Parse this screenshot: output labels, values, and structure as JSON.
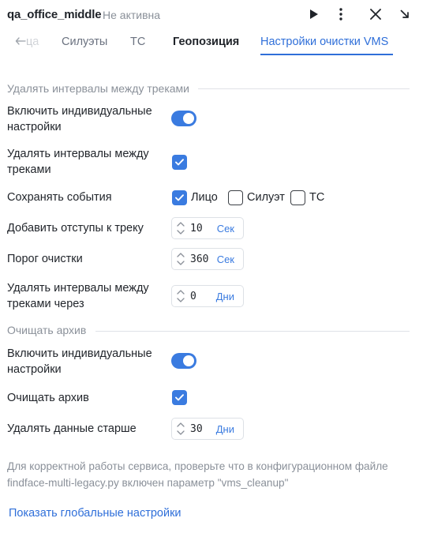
{
  "header": {
    "title": "qa_office_middle",
    "status": "Не активна",
    "icons": [
      "play-icon",
      "kebab-menu-icon",
      "close-icon",
      "collapse-icon"
    ]
  },
  "tabs": [
    {
      "label": "ца",
      "truncated": true
    },
    {
      "label": "Силуэты"
    },
    {
      "label": "ТС"
    },
    {
      "label": "Геопозиция"
    },
    {
      "label": "Настройки очистки VMS",
      "active": true
    }
  ],
  "section_intervals": {
    "title": "Удалять интервалы между треками",
    "individual_label": "Включить индивидуальные настройки",
    "individual_on": true,
    "remove_intervals_label": "Удалять интервалы между треками",
    "remove_intervals_checked": true,
    "keep_events_label": "Сохранять события",
    "events": [
      {
        "label": "Лицо",
        "checked": true
      },
      {
        "label": "Силуэт",
        "checked": false
      },
      {
        "label": "ТС",
        "checked": false
      }
    ],
    "padding_label": "Добавить отступы к треку",
    "padding_value": "10",
    "padding_unit": "Сек",
    "threshold_label": "Порог очистки",
    "threshold_value": "360",
    "threshold_unit": "Сек",
    "remove_after_label": "Удалять интервалы между треками через",
    "remove_after_value": "0",
    "remove_after_unit": "Дни"
  },
  "section_archive": {
    "title": "Очищать архив",
    "individual_label": "Включить индивидуальные настройки",
    "individual_on": true,
    "clear_archive_label": "Очищать архив",
    "clear_archive_checked": true,
    "older_label": "Удалять данные старше",
    "older_value": "30",
    "older_unit": "Дни"
  },
  "note": "Для корректной работы сервиса, проверьте что в конфигурационном файле findface-multi-legacy.py включен параметр \"vms_cleanup\"",
  "link_label": "Показать глобальные настройки",
  "colors": {
    "accent": "#3a7be0",
    "muted": "#8a9099",
    "text": "#1f2329"
  }
}
